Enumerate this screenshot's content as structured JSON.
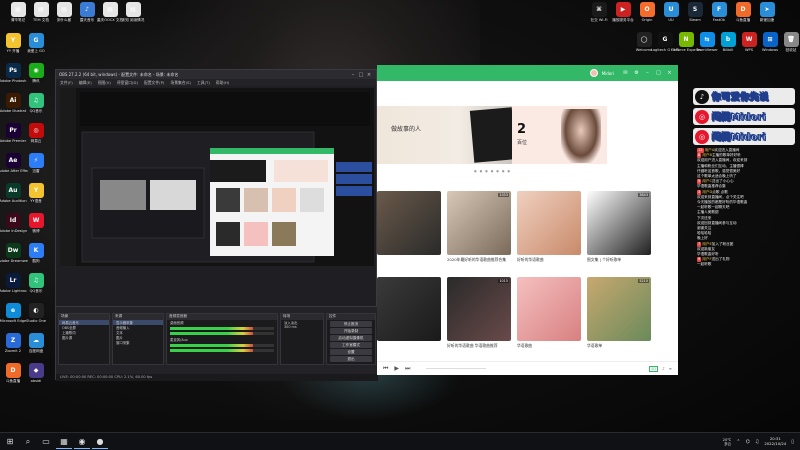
{
  "desktop": {
    "top_left_icons": [
      {
        "label": "清华笔记",
        "color": "#e6e6e6",
        "glyph": "▤"
      },
      {
        "label": "TEM 文档",
        "color": "#e6e6e6",
        "glyph": "▤"
      },
      {
        "label": "到什么都",
        "color": "#e6e6e6",
        "glyph": "▤"
      },
      {
        "label": "露天音乐",
        "color": "#3a7bd5",
        "glyph": "♪"
      },
      {
        "label": "重庆OOCX 文档",
        "color": "#e6e6e6",
        "glyph": "▤"
      },
      {
        "label": "未知 阅读情况",
        "color": "#e6e6e6",
        "glyph": "▤"
      }
    ],
    "left_column_icons": [
      {
        "label": "YY 开播",
        "color": "#f4c430",
        "glyph": "Y"
      },
      {
        "label": "我爱上 GO",
        "color": "#2a8dd8",
        "glyph": "G"
      },
      {
        "label": "Adobe Photosh",
        "color": "#0a2a4a",
        "glyph": "Ps"
      },
      {
        "label": "腾讯",
        "color": "#1aad19",
        "glyph": "◉"
      },
      {
        "label": "Adobe Illustrat",
        "color": "#3a1a00",
        "glyph": "Ai"
      },
      {
        "label": "QQ音乐",
        "color": "#31c27c",
        "glyph": "♫"
      },
      {
        "label": "Adobe Premier",
        "color": "#1a0033",
        "glyph": "Pr"
      },
      {
        "label": "网易云",
        "color": "#c20c0c",
        "glyph": "◎"
      },
      {
        "label": "Adobe After Effects",
        "color": "#1a0033",
        "glyph": "Ae"
      },
      {
        "label": "迅雷",
        "color": "#2d7df6",
        "glyph": "⚡"
      },
      {
        "label": "Adobe Audition",
        "color": "#0a3a2a",
        "glyph": "Au"
      },
      {
        "label": "YY语音",
        "color": "#f4c430",
        "glyph": "Y"
      },
      {
        "label": "Adobe InDesign",
        "color": "#3a0a1a",
        "glyph": "Id"
      },
      {
        "label": "微博",
        "color": "#e6162d",
        "glyph": "W"
      },
      {
        "label": "Adobe Dreamwe",
        "color": "#0a3a1a",
        "glyph": "Dw"
      },
      {
        "label": "酷狗",
        "color": "#2d7df6",
        "glyph": "K"
      },
      {
        "label": "Adobe Lightroo",
        "color": "#0a1a3a",
        "glyph": "Lr"
      },
      {
        "label": "QQ音乐",
        "color": "#31c27c",
        "glyph": "♫"
      },
      {
        "label": "Microsoft Edge",
        "color": "#0f8cd8",
        "glyph": "e"
      },
      {
        "label": "Studio One",
        "color": "#222",
        "glyph": "◐"
      },
      {
        "label": "Zoomit 2",
        "color": "#2a6ad8",
        "glyph": "Z"
      },
      {
        "label": "百度网盘",
        "color": "#2a8dd8",
        "glyph": "☁"
      },
      {
        "label": "斗鱼直播",
        "color": "#f06a2a",
        "glyph": "D"
      },
      {
        "label": "obsidi",
        "color": "#4a3a8a",
        "glyph": "◆"
      }
    ],
    "right_icons_row1": [
      {
        "label": "社交 Wi-Fi",
        "color": "#1a1a1a",
        "glyph": "⌘"
      },
      {
        "label": "播放服务平台",
        "color": "#c22",
        "glyph": "▶"
      },
      {
        "label": "Origin",
        "color": "#f56c2d",
        "glyph": "O"
      },
      {
        "label": "UU",
        "color": "#2a8dd8",
        "glyph": "U"
      },
      {
        "label": "Steam",
        "color": "#1b2838",
        "glyph": "S"
      },
      {
        "label": "FastOk",
        "color": "#2a8dd8",
        "glyph": "F"
      },
      {
        "label": "斗鱼直播",
        "color": "#f06a2a",
        "glyph": "D"
      },
      {
        "label": "新速加速",
        "color": "#2a8dd8",
        "glyph": "➤"
      }
    ],
    "right_icons_row2": [
      {
        "label": "Welcome",
        "color": "#222",
        "glyph": "◯"
      },
      {
        "label": "Logitech G HUB",
        "color": "#111",
        "glyph": "G"
      },
      {
        "label": "GeForce Experience",
        "color": "#76b900",
        "glyph": "N"
      },
      {
        "label": "TeamViewer",
        "color": "#0e8ee9",
        "glyph": "⇆"
      },
      {
        "label": "Bilibili",
        "color": "#00a1d6",
        "glyph": "b"
      },
      {
        "label": "WPS",
        "color": "#c22",
        "glyph": "W"
      },
      {
        "label": "Windows",
        "color": "#0a64c8",
        "glyph": "⊞"
      },
      {
        "label": "回收站",
        "color": "#888",
        "glyph": "🗑"
      }
    ]
  },
  "obs": {
    "title": "OBS 27.2.2 (64 bit, windows) - 配置文件: 未命名 - 场景: 未命名",
    "menu": [
      "文件(F)",
      "编辑(E)",
      "视图(V)",
      "停靠窗口(D)",
      "配置文件(P)",
      "场景集合(S)",
      "工具(T)",
      "帮助(H)"
    ],
    "docks": {
      "scenes": {
        "title": "场景",
        "items": [
          "网易云音乐",
          "OBS全屏",
          "上播歌词",
          "图片源"
        ]
      },
      "sources": {
        "title": "来源",
        "items": [
          "显示器采集",
          "音频输入",
          "文本",
          "图片",
          "窗口采集"
        ]
      },
      "mixer": {
        "title": "音频混音器",
        "channels": [
          "桌面音频",
          "麦克风/Aux"
        ]
      },
      "transitions": {
        "title": "转场",
        "value": "淡入淡出",
        "duration": "300 ms"
      },
      "controls": {
        "title": "控件",
        "buttons": [
          "停止推流",
          "开始录制",
          "启动虚拟摄像机",
          "工作室模式",
          "设置",
          "退出"
        ]
      }
    },
    "status": "LIVE: 00:00:00   REC: 00:00:00   CPU: 2.1%, 60.00 fps"
  },
  "music": {
    "username": "Midori",
    "banner1_text": "做故事的人",
    "banner2_num": "2",
    "banner2_text": "百位",
    "banner2_caption": "This Day In Music",
    "cards": [
      {
        "plays": "",
        "title": "",
        "colors": [
          "#6a5a4a",
          "#2a2a2a"
        ]
      },
      {
        "plays": "1353",
        "title": "2020年最好听的华语歌曲推荐合集",
        "colors": [
          "#d8c8b8",
          "#7a6a5a"
        ]
      },
      {
        "plays": "",
        "title": "好听的华语歌曲",
        "colors": [
          "#f0d0c0",
          "#c88a6a"
        ]
      },
      {
        "plays": "3843",
        "title": "图文集 | 个好听歌单",
        "colors": [
          "#ffffff",
          "#202020"
        ]
      },
      {
        "plays": "",
        "title": "",
        "colors": [
          "#3a3a3a",
          "#1a1a1a"
        ]
      },
      {
        "plays": "1015",
        "title": "好听的华语歌曲 华语歌曲推荐",
        "colors": [
          "#2a2a2a",
          "#6a4a4a"
        ]
      },
      {
        "plays": "",
        "title": "华语歌曲",
        "colors": [
          "#f5c0c0",
          "#d88080"
        ]
      },
      {
        "plays": "5210",
        "title": "华语歌单",
        "colors": [
          "#c8a870",
          "#6a8a5a"
        ]
      }
    ]
  },
  "overlay": {
    "badges": [
      {
        "icon": "♪",
        "icon_color": "#111",
        "text": "你可爱你先说"
      },
      {
        "icon": "◎",
        "icon_color": "#e6162d",
        "text": "闲阁Midori"
      },
      {
        "icon": "◎",
        "icon_color": "#e6162d",
        "text": "闲阁Midori"
      }
    ],
    "chat": [
      {
        "level": "12",
        "name": "用户A",
        "text": "欢迎进入直播间"
      },
      {
        "level": "8",
        "name": "用户B",
        "text": "主播的歌单好好听"
      },
      {
        "level": "",
        "name": "",
        "text": "欢迎用户进入直播间，欢迎来到"
      },
      {
        "level": "",
        "name": "",
        "text": "主播和粉丝们互动，主播很棒"
      },
      {
        "level": "",
        "name": "",
        "text": "仔细听这首歌，感觉很美好"
      },
      {
        "level": "",
        "name": "",
        "text": "这个歌单太适合晚上听了"
      },
      {
        "level": "5",
        "name": "用户C",
        "text": "送出了小心心"
      },
      {
        "level": "",
        "name": "",
        "text": "华语歌曲推荐合集"
      },
      {
        "level": "3",
        "name": "用户D",
        "text": "点歌 点歌"
      },
      {
        "level": "",
        "name": "",
        "text": "欢迎来到直播间，点个关注吧"
      },
      {
        "level": "",
        "name": "",
        "text": "今天播放的都是好听的华语歌曲"
      },
      {
        "level": "",
        "name": "",
        "text": "一起听歌一起聊天吧"
      },
      {
        "level": "",
        "name": "",
        "text": "主播人美歌甜"
      },
      {
        "level": "",
        "name": "",
        "text": "下次还来"
      },
      {
        "level": "",
        "name": "",
        "text": "欢迎回到直播间参与互动"
      },
      {
        "level": "",
        "name": "",
        "text": "谢谢关注"
      },
      {
        "level": "",
        "name": "",
        "text": "哈哈哈哈"
      },
      {
        "level": "",
        "name": "",
        "text": "晚上好"
      },
      {
        "level": "7",
        "name": "用户E",
        "text": "加入了粉丝团"
      },
      {
        "level": "",
        "name": "",
        "text": "欢迎新朋友"
      },
      {
        "level": "",
        "name": "",
        "text": "华语歌曲好听"
      },
      {
        "level": "9",
        "name": "用户F",
        "text": "送出了礼物"
      },
      {
        "level": "",
        "name": "",
        "text": "一起听歌"
      }
    ]
  },
  "taskbar": {
    "apps": [
      "⊞",
      "⌕",
      "▭",
      "▦",
      "◉",
      "●"
    ],
    "weather_temp": "20℃",
    "weather_desc": "多云",
    "time": "20:31",
    "date": "2022/10/24"
  }
}
